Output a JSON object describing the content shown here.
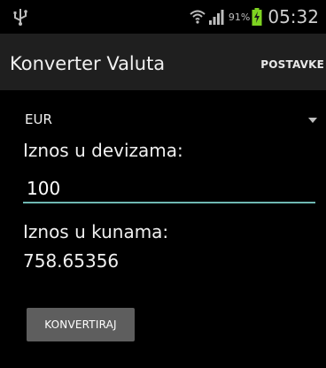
{
  "status_bar": {
    "usb_icon": "usb-icon",
    "wifi_icon": "wifi-icon",
    "signal_icon": "signal-icon",
    "battery_percent": "91%",
    "battery_icon": "battery-charging-icon",
    "time": "05:32"
  },
  "action_bar": {
    "title": "Konverter Valuta",
    "settings_label": "POSTAVKE"
  },
  "form": {
    "currency_selected": "EUR",
    "foreign_amount_label": "Iznos u devizama:",
    "foreign_amount_value": "100",
    "kuna_amount_label": "Iznos u kunama:",
    "result_value": "758.65356",
    "convert_button_label": "KONVERTIRAJ"
  },
  "colors": {
    "background": "#000000",
    "action_bar": "#1f1f1f",
    "input_underline": "#6fb8b3",
    "button": "#5e5e5e",
    "battery_charging": "#7ed321"
  }
}
